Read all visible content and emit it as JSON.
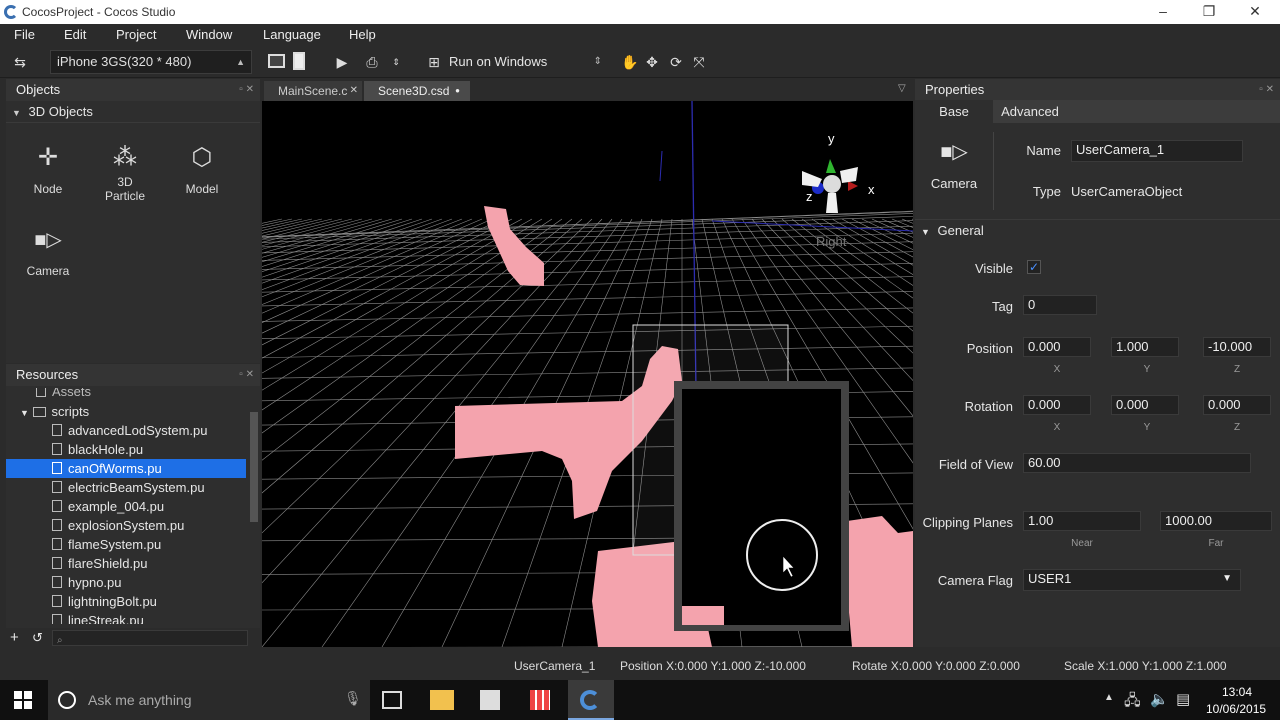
{
  "window": {
    "title": "CocosProject - Cocos Studio",
    "minimize": "–",
    "maximize": "❐",
    "close": "✕"
  },
  "menu": [
    "File",
    "Edit",
    "Project",
    "Window",
    "Language",
    "Help"
  ],
  "toolbar": {
    "device": "iPhone 3GS(320 * 480)",
    "run_target": "Run on Windows"
  },
  "objects_panel": {
    "title": "Objects",
    "section": "3D Objects",
    "items": [
      {
        "label": "Node",
        "icon": "node-icon"
      },
      {
        "label": "3D Particle",
        "label1": "3D",
        "label2": "Particle",
        "icon": "particle-icon"
      },
      {
        "label": "Model",
        "icon": "model-icon"
      },
      {
        "label": "Camera",
        "icon": "camera-icon"
      }
    ]
  },
  "resources_panel": {
    "title": "Resources",
    "partial_top": "Assets",
    "folder": "scripts",
    "files": [
      "advancedLodSystem.pu",
      "blackHole.pu",
      "canOfWorms.pu",
      "electricBeamSystem.pu",
      "example_004.pu",
      "explosionSystem.pu",
      "flameSystem.pu",
      "flareShield.pu",
      "hypno.pu",
      "lightningBolt.pu",
      "lineStreak.pu"
    ],
    "selected": "canOfWorms.pu",
    "add": "+",
    "refresh": "↺"
  },
  "editor": {
    "tabs": [
      {
        "label": "MainScene.c",
        "active": false
      },
      {
        "label": "Scene3D.csd",
        "active": true
      }
    ],
    "gizmo": {
      "x": "x",
      "y": "y",
      "z": "z",
      "view": "Right"
    }
  },
  "properties": {
    "title": "Properties",
    "tabs": [
      "Base",
      "Advanced"
    ],
    "icon_label": "Camera",
    "name_label": "Name",
    "name_value": "UserCamera_1",
    "type_label": "Type",
    "type_value": "UserCameraObject",
    "section": "General",
    "visible_label": "Visible",
    "visible": true,
    "tag_label": "Tag",
    "tag_value": "0",
    "position_label": "Position",
    "position": [
      "0.000",
      "1.000",
      "-10.000"
    ],
    "rotation_label": "Rotation",
    "rotation": [
      "0.000",
      "0.000",
      "0.000"
    ],
    "axes": [
      "X",
      "Y",
      "Z"
    ],
    "fov_label": "Field of View",
    "fov": "60.00",
    "clip_label": "Clipping Planes",
    "near": "1.00",
    "far": "1000.00",
    "near_label": "Near",
    "far_label": "Far",
    "flag_label": "Camera Flag",
    "flag": "USER1"
  },
  "status": {
    "name": "UserCamera_1",
    "position": "Position X:0.000   Y:1.000   Z:-10.000",
    "rotate": "Rotate X:0.000   Y:0.000   Z:0.000",
    "scale": "Scale X:1.000   Y:1.000   Z:1.000"
  },
  "taskbar": {
    "search": "Ask me anything",
    "time": "13:04",
    "date": "10/06/2015"
  },
  "colors": {
    "selection": "#1e6fe6",
    "particle": "#f4a3ad",
    "accent": "#3a6fb0"
  }
}
